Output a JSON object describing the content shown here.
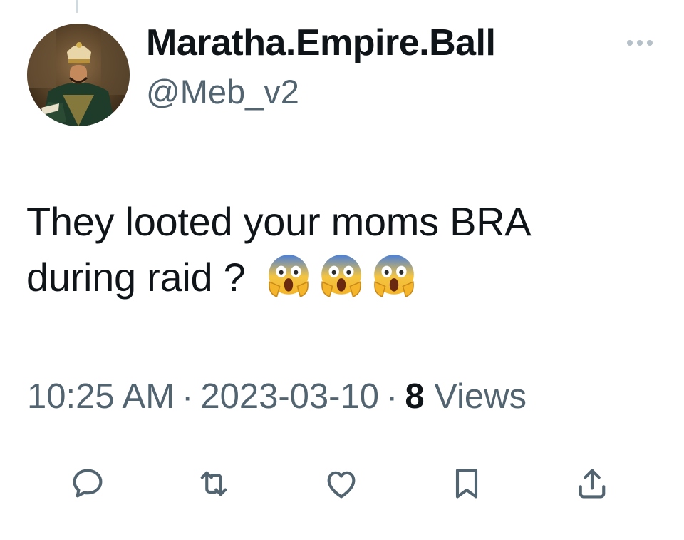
{
  "tweet": {
    "display_name": "Maratha.Empire.Ball",
    "handle": "@Meb_v2",
    "text_line1": "They looted your moms BRA",
    "text_line2": "during raid ?",
    "emojis": [
      "😱",
      "😱",
      "😱"
    ],
    "time": "10:25 AM",
    "date": "2023-03-10",
    "separator": "·",
    "views_count": "8",
    "views_label": "Views"
  },
  "actions": [
    {
      "name": "reply",
      "icon": "speech-bubble-icon"
    },
    {
      "name": "retweet",
      "icon": "retweet-arrows-icon"
    },
    {
      "name": "like",
      "icon": "heart-icon"
    },
    {
      "name": "bookmark",
      "icon": "bookmark-icon"
    },
    {
      "name": "share",
      "icon": "share-upload-icon"
    }
  ],
  "colors": {
    "text_primary": "#0f1419",
    "text_secondary": "#536471",
    "icon": "#536471",
    "thread_line": "#cfd9de"
  }
}
